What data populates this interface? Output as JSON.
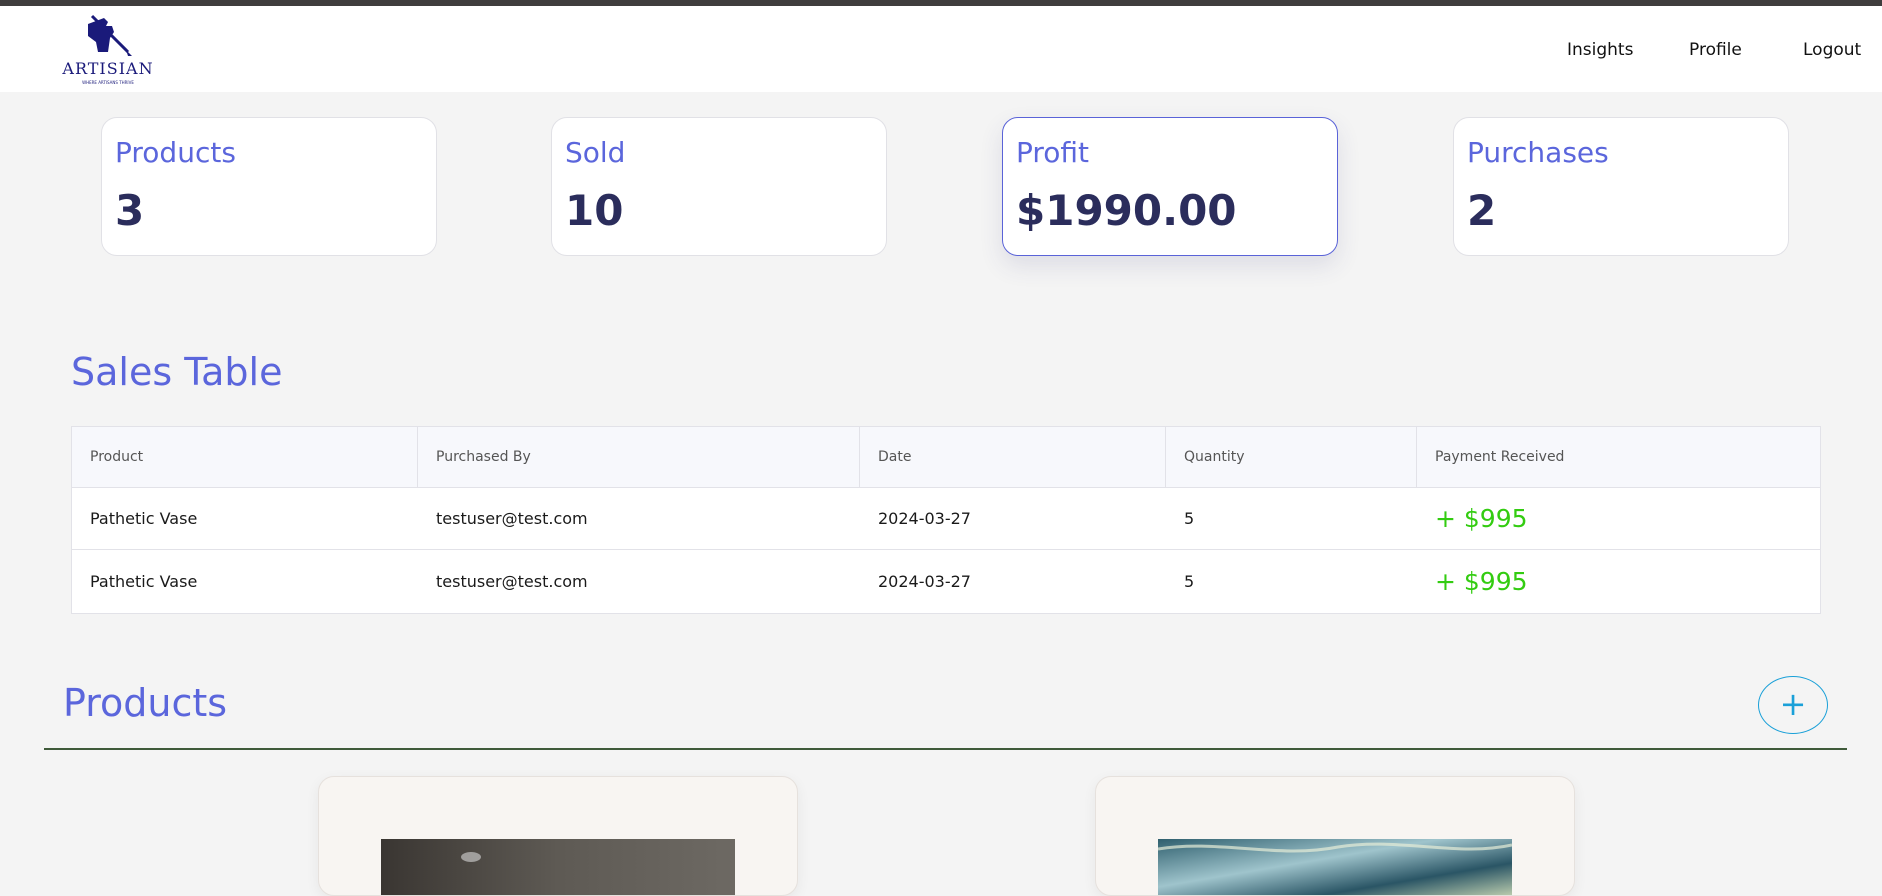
{
  "header": {
    "logo": {
      "word": "ARTISIAN",
      "tagline": "WHERE ARTISANS THRIVE"
    },
    "nav": [
      {
        "label": "Insights"
      },
      {
        "label": "Profile"
      },
      {
        "label": "Logout"
      }
    ]
  },
  "stats": [
    {
      "label": "Products",
      "value": "3"
    },
    {
      "label": "Sold",
      "value": "10"
    },
    {
      "label": "Profit",
      "value": "$1990.00"
    },
    {
      "label": "Purchases",
      "value": "2"
    }
  ],
  "sales_table": {
    "title": "Sales Table",
    "columns": [
      "Product",
      "Purchased By",
      "Date",
      "Quantity",
      "Payment Received"
    ],
    "rows": [
      {
        "product": "Pathetic Vase",
        "purchased_by": "testuser@test.com",
        "date": "2024-03-27",
        "quantity": "5",
        "payment": "+ $995"
      },
      {
        "product": "Pathetic Vase",
        "purchased_by": "testuser@test.com",
        "date": "2024-03-27",
        "quantity": "5",
        "payment": "+ $995"
      }
    ]
  },
  "products": {
    "title": "Products",
    "add_label": "+"
  },
  "colors": {
    "accent": "#5b66dc",
    "value_text": "#2b2d5c",
    "payment_green": "#33cc11",
    "add_button": "#1aa0d8"
  }
}
